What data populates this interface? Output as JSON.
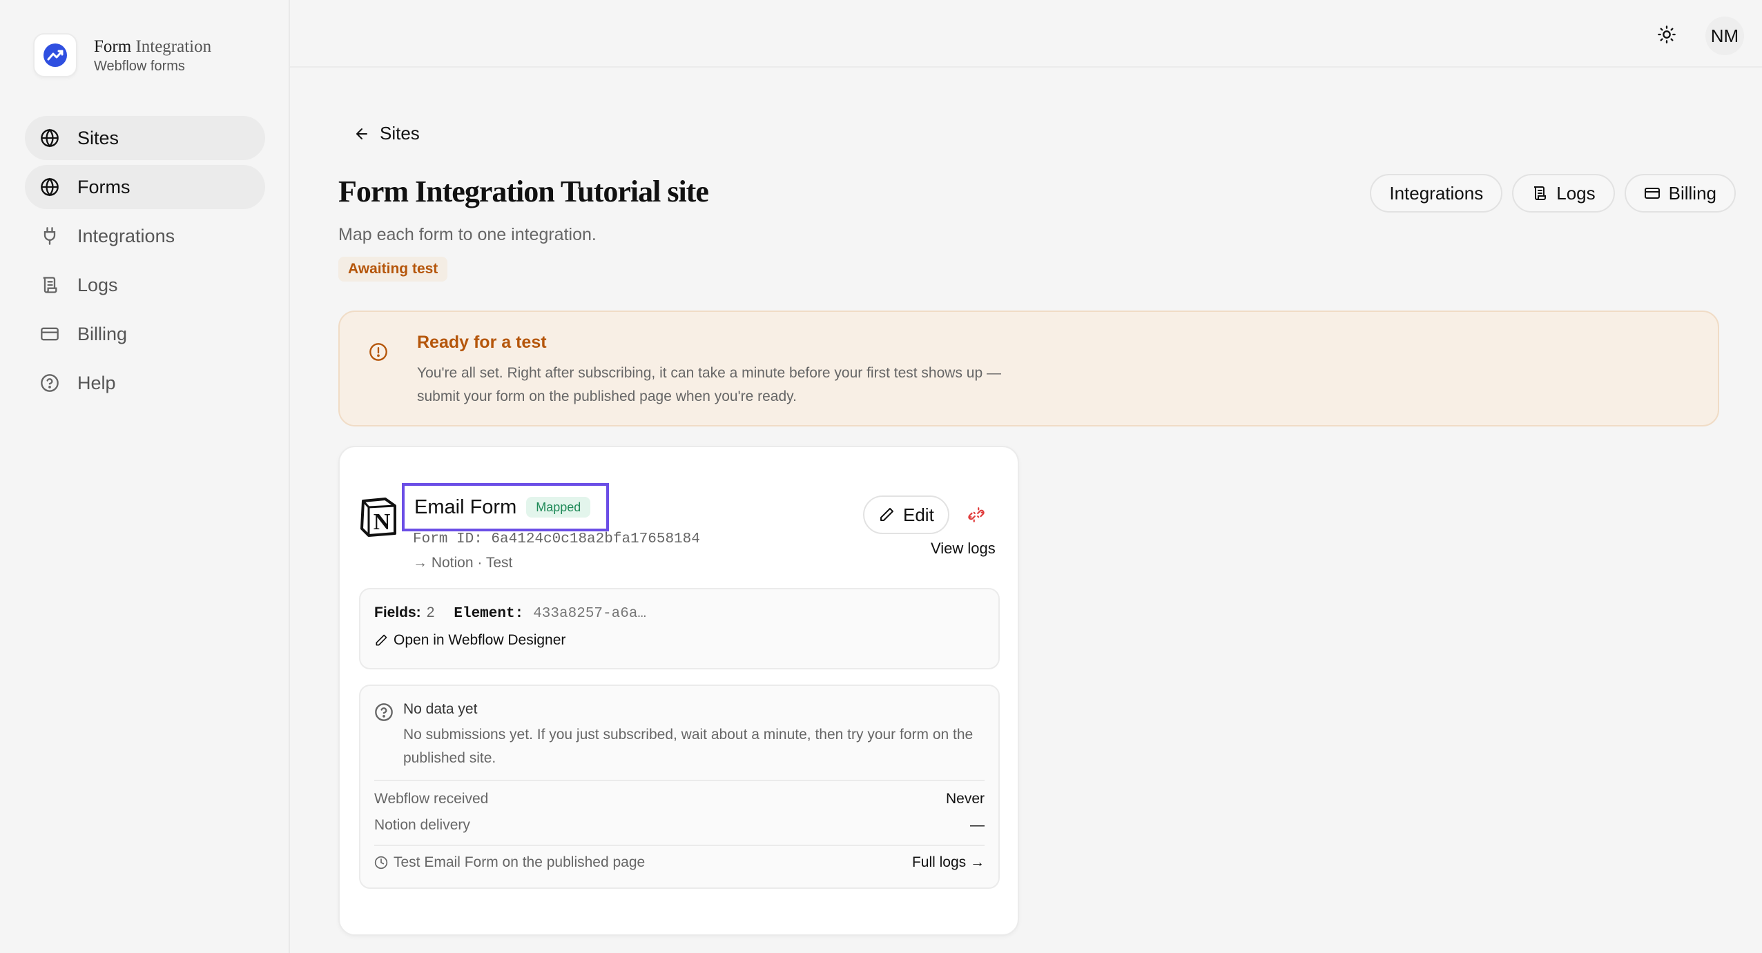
{
  "brand": {
    "title_main": "Form",
    "title_light": "Integration",
    "subtitle": "Webflow forms",
    "accent": "#2f4fe0"
  },
  "sidebar": {
    "items": [
      {
        "label": "Sites",
        "icon": "globe-icon",
        "active": true
      },
      {
        "label": "Forms",
        "icon": "globe-icon",
        "active": true
      },
      {
        "label": "Integrations",
        "icon": "plug-icon",
        "active": false
      },
      {
        "label": "Logs",
        "icon": "scroll-icon",
        "active": false
      },
      {
        "label": "Billing",
        "icon": "credit-card-icon",
        "active": false
      },
      {
        "label": "Help",
        "icon": "help-circle-icon",
        "active": false
      }
    ]
  },
  "topbar": {
    "theme_icon": "sun-icon",
    "avatar_initials": "NM"
  },
  "page": {
    "back_label": "Sites",
    "title": "Form Integration Tutorial site",
    "subtitle": "Map each form to one integration.",
    "status": "Awaiting test",
    "status_color": "#b5560b",
    "actions": [
      {
        "label": "Integrations",
        "icon": ""
      },
      {
        "label": "Logs",
        "icon": "scroll-icon"
      },
      {
        "label": "Billing",
        "icon": "credit-card-icon"
      }
    ]
  },
  "alert": {
    "title": "Ready for a test",
    "body": "You're all set. Right after subscribing, it can take a minute before your first test shows up — submit your form on the published page when you're ready."
  },
  "form_card": {
    "name": "Email Form",
    "badge": "Mapped",
    "form_id_label": "Form ID: 6a4124c0c18a2bfa17658184",
    "route": "→ Notion · Test",
    "edit_label": "Edit",
    "view_logs_label": "View logs",
    "fields_label": "Fields:",
    "fields_value": "2",
    "element_label": "Element:",
    "element_value": "433a8257-a6a…",
    "open_designer_label": "Open in Webflow Designer",
    "nodata_title": "No data yet",
    "nodata_body": "No submissions yet. If you just subscribed, wait about a minute, then try your form on the published site.",
    "stats": [
      {
        "label": "Webflow received",
        "value": "Never"
      },
      {
        "label": "Notion delivery",
        "value": "—"
      }
    ],
    "test_line": "Test Email Form on the published page",
    "full_logs_label": "Full logs →"
  }
}
